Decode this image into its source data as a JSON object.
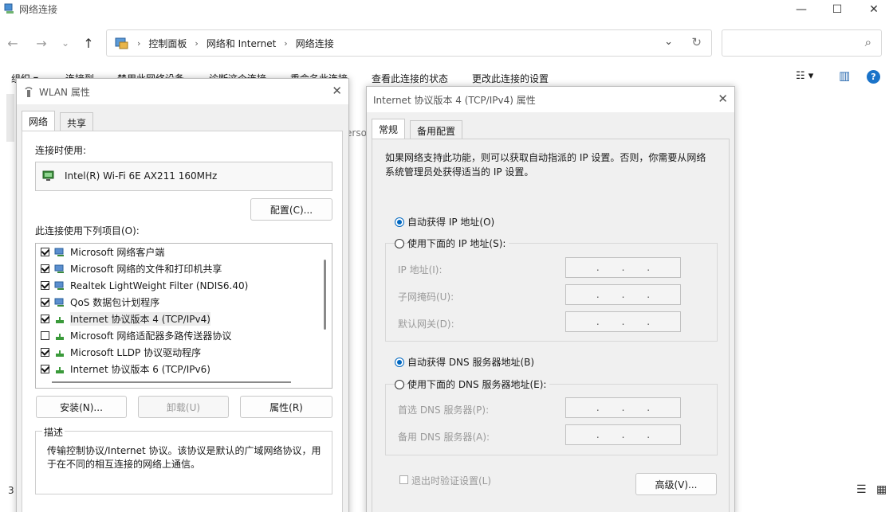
{
  "window": {
    "title": "网络连接",
    "minimize": "—",
    "maximize": "☐",
    "close": "✕"
  },
  "nav": {
    "back": "←",
    "forward": "→",
    "recent": "⌄",
    "up": "↑",
    "breadcrumbs": [
      "控制面板",
      "网络和 Internet",
      "网络连接"
    ],
    "refresh": "↻",
    "dropdown": "⌄",
    "search_icon": "⌕"
  },
  "toolbar": {
    "items": [
      "组织 ▾",
      "连接到",
      "禁用此网络设备",
      "诊断这个连接",
      "重命名此连接",
      "查看此连接的状态",
      "更改此连接的设置"
    ],
    "view_icon": "☷ ▾",
    "pane_icon": "▥",
    "help": "?"
  },
  "status": {
    "count": "3",
    "details_view": "☰",
    "tiles_view": "▦",
    "partial_bg_text": "erso"
  },
  "wlan": {
    "title": "WLAN 属性",
    "close": "✕",
    "tabs": [
      "网络",
      "共享"
    ],
    "connect_using_label": "连接时使用:",
    "adapter_name": "Intel(R) Wi-Fi 6E AX211 160MHz",
    "configure_button": "配置(C)...",
    "items_label": "此连接使用下列项目(O):",
    "items": [
      {
        "label": "Microsoft 网络客户端",
        "checked": true
      },
      {
        "label": "Microsoft 网络的文件和打印机共享",
        "checked": true
      },
      {
        "label": "Realtek LightWeight Filter (NDIS6.40)",
        "checked": true
      },
      {
        "label": "QoS 数据包计划程序",
        "checked": true
      },
      {
        "label": "Internet 协议版本 4 (TCP/IPv4)",
        "checked": true
      },
      {
        "label": "Microsoft 网络适配器多路传送器协议",
        "checked": false
      },
      {
        "label": "Microsoft LLDP 协议驱动程序",
        "checked": true
      },
      {
        "label": "Internet 协议版本 6 (TCP/IPv6)",
        "checked": true
      }
    ],
    "install_button": "安装(N)...",
    "uninstall_button": "卸载(U)",
    "properties_button": "属性(R)",
    "description_title": "描述",
    "description_text": "传输控制协议/Internet 协议。该协议是默认的广域网络协议，用于在不同的相互连接的网络上通信。"
  },
  "ipv4": {
    "title": "Internet 协议版本 4 (TCP/IPv4) 属性",
    "close": "✕",
    "tabs": [
      "常规",
      "备用配置"
    ],
    "intro": "如果网络支持此功能，则可以获取自动指派的 IP 设置。否则，你需要从网络系统管理员处获得适当的 IP 设置。",
    "auto_ip": "自动获得 IP 地址(O)",
    "manual_ip": "使用下面的 IP 地址(S):",
    "ip_address": "IP 地址(I):",
    "subnet_mask": "子网掩码(U):",
    "default_gateway": "默认网关(D):",
    "auto_dns": "自动获得 DNS 服务器地址(B)",
    "manual_dns": "使用下面的 DNS 服务器地址(E):",
    "preferred_dns": "首选 DNS 服务器(P):",
    "alternate_dns": "备用 DNS 服务器(A):",
    "validate_on_exit": "退出时验证设置(L)",
    "advanced_button": "高级(V)...",
    "ip_dots": "."
  }
}
